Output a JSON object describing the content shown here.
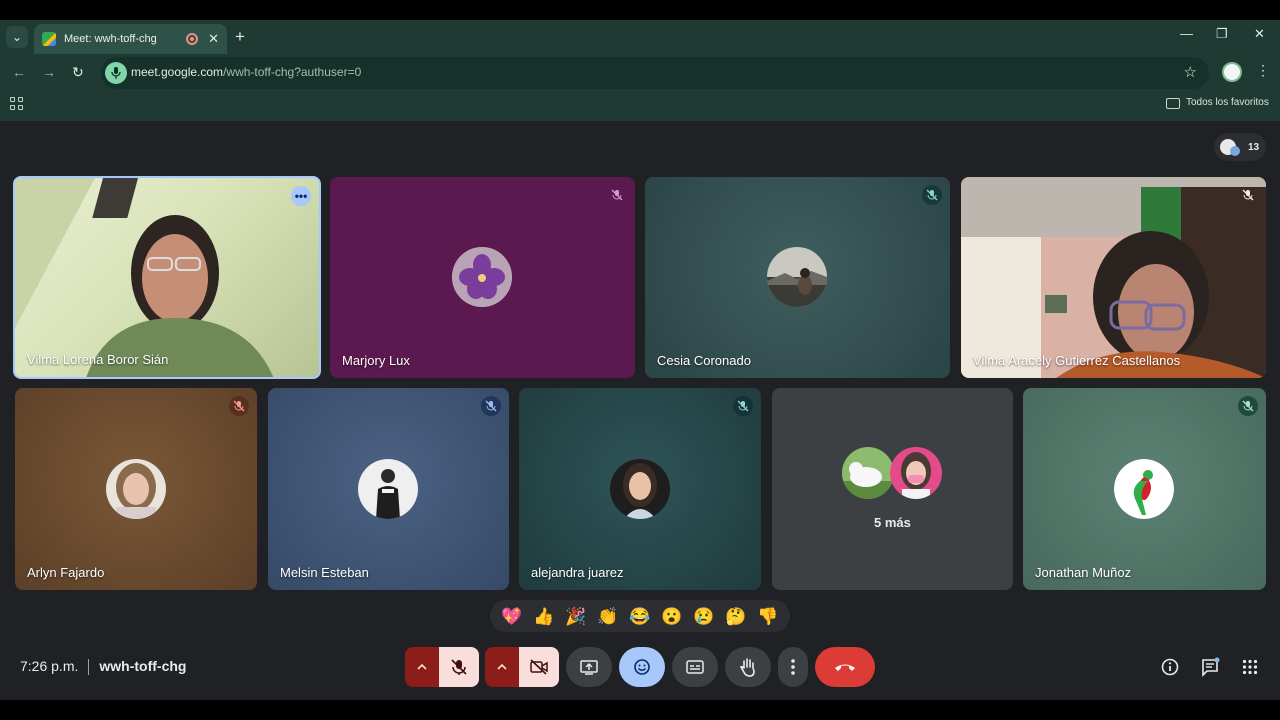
{
  "browser": {
    "tab_title": "Meet: wwh-toff-chg",
    "url_main": "meet.google.com",
    "url_path": "/wwh-toff-chg?authuser=0",
    "bookmarks_label": "Todos los favoritos",
    "new_tab_symbol": "+",
    "close_tab_symbol": "✕",
    "tab_list_symbol": "⌄",
    "minimize_symbol": "—",
    "restore_symbol": "❐",
    "close_window_symbol": "✕",
    "back_symbol": "←",
    "forward_symbol": "→",
    "reload_symbol": "↻",
    "star_symbol": "☆",
    "menu_symbol": "⋮"
  },
  "meet": {
    "participant_count": "13",
    "participants_top": [
      {
        "name": "Vilma Lorena Boror Sián"
      },
      {
        "name": "Marjory Lux"
      },
      {
        "name": "Cesia Coronado"
      },
      {
        "name": "Vilma Aracely Gutierrez Castellanos"
      }
    ],
    "participants_bottom": [
      {
        "name": "Arlyn Fajardo"
      },
      {
        "name": "Melsin Esteban"
      },
      {
        "name": "alejandra juarez"
      },
      {
        "name": "5 más"
      },
      {
        "name": "Jonathan Muñoz"
      }
    ],
    "reactions": [
      "💖",
      "👍",
      "🎉",
      "👏",
      "😂",
      "😮",
      "😢",
      "🤔",
      "👎"
    ],
    "time": "7:26 p.m.",
    "meeting_code": "wwh-toff-chg",
    "more_dots": "•••"
  },
  "colors": {
    "chrome_bg": "#1f3a33",
    "meet_bg": "#202124",
    "end_call": "#dc3b36",
    "muted_btn_bg": "#f9dedc",
    "caret_btn_bg": "#8c1d18",
    "reaction_btn_bg": "#a8c7fa"
  }
}
